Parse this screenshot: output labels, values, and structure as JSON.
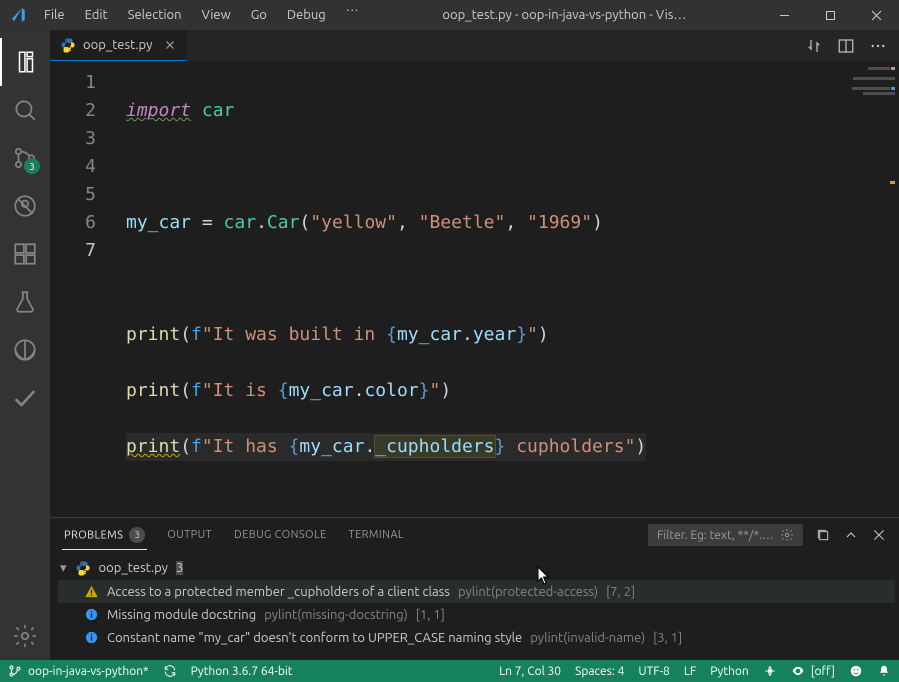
{
  "titlebar": {
    "menus": [
      "File",
      "Edit",
      "Selection",
      "View",
      "Go",
      "Debug"
    ],
    "ellipsis": "…",
    "title": "oop_test.py - oop-in-java-vs-python - Vis…"
  },
  "activity": {
    "scm_badge": "3"
  },
  "tabs": {
    "file": "oop_test.py"
  },
  "code": {
    "line_numbers": [
      "1",
      "2",
      "3",
      "4",
      "5",
      "6",
      "7"
    ],
    "l1_kw": "import",
    "l1_mod": "car",
    "l3_var": "my_car",
    "l3_eq": " = ",
    "l3_mod": "car",
    "l3_dot": ".",
    "l3_cls": "Car",
    "l3_args_open": "(",
    "l3_s1": "\"yellow\"",
    "l3_c1": ", ",
    "l3_s2": "\"Beetle\"",
    "l3_c2": ", ",
    "l3_s3": "\"1969\"",
    "l3_args_close": ")",
    "l5_fn": "print",
    "l5_po": "(",
    "l5_f": "f",
    "l5_sq": "\"It was built in ",
    "l5_br_o": "{",
    "l5_obj": "my_car",
    "l5_dot": ".",
    "l5_attr": "year",
    "l5_br_c": "}",
    "l5_se": "\"",
    "l5_pc": ")",
    "l6_fn": "print",
    "l6_po": "(",
    "l6_f": "f",
    "l6_sq": "\"It is ",
    "l6_br_o": "{",
    "l6_obj": "my_car",
    "l6_dot": ".",
    "l6_attr": "color",
    "l6_br_c": "}",
    "l6_se": "\"",
    "l6_pc": ")",
    "l7_fn": "print",
    "l7_po": "(",
    "l7_f": "f",
    "l7_sq": "\"It has ",
    "l7_br_o": "{",
    "l7_obj": "my_car",
    "l7_dot": ".",
    "l7_attr": "_cupholders",
    "l7_br_c": "}",
    "l7_tail": " cupholders\"",
    "l7_pc": ")"
  },
  "panel": {
    "tabs": {
      "problems": "PROBLEMS",
      "problems_badge": "3",
      "output": "OUTPUT",
      "debug": "DEBUG CONSOLE",
      "terminal": "TERMINAL"
    },
    "filter_placeholder": "Filter. Eg: text, **/*.…",
    "file": "oop_test.py",
    "file_count": "3",
    "items": [
      {
        "sev": "warn",
        "msg": "Access to a protected member _cupholders of a client class",
        "src": "pylint(protected-access)",
        "loc": "[7, 2]"
      },
      {
        "sev": "info",
        "msg": "Missing module docstring",
        "src": "pylint(missing-docstring)",
        "loc": "[1, 1]"
      },
      {
        "sev": "info",
        "msg": "Constant name \"my_car\" doesn't conform to UPPER_CASE naming style",
        "src": "pylint(invalid-name)",
        "loc": "[3, 1]"
      }
    ]
  },
  "status": {
    "branch": "oop-in-java-vs-python*",
    "python": "Python 3.6.7 64-bit",
    "pos": "Ln 7, Col 30",
    "spaces": "Spaces: 4",
    "enc": "UTF-8",
    "eol": "LF",
    "lang": "Python",
    "live": "[off]"
  }
}
